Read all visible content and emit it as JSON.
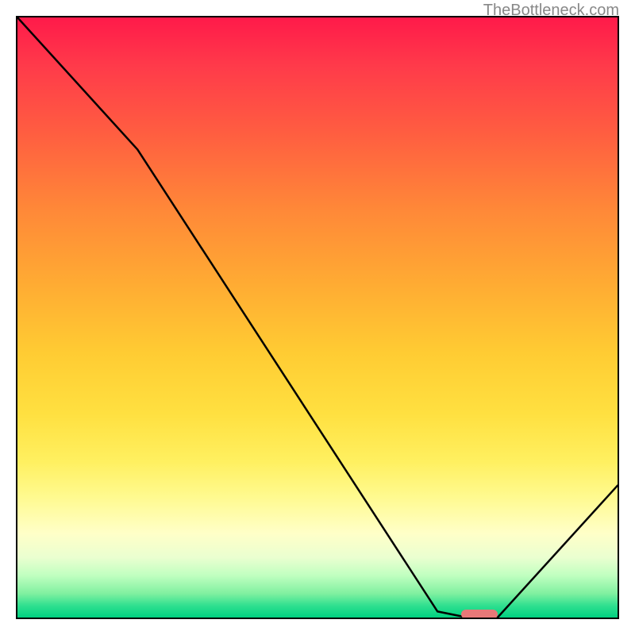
{
  "watermark": "TheBottleneck.com",
  "chart_data": {
    "type": "line",
    "title": "",
    "xlabel": "",
    "ylabel": "",
    "xlim": [
      0,
      100
    ],
    "ylim": [
      0,
      100
    ],
    "series": [
      {
        "name": "curve",
        "x": [
          0,
          20,
          70,
          75,
          80,
          100
        ],
        "values": [
          100,
          78,
          1,
          0,
          0,
          22
        ]
      }
    ],
    "marker": {
      "x_start": 74,
      "x_end": 80,
      "y": 0.5
    },
    "background_gradient": {
      "top": "#ff1a4a",
      "mid": "#ffe040",
      "bottom": "#00d080"
    }
  }
}
